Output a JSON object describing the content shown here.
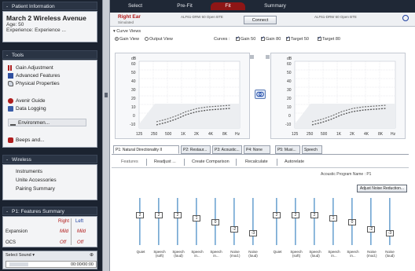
{
  "patient": {
    "header": "Patient Information",
    "name": "March 2 Wireless Avenue",
    "age": "Age: 50",
    "experience": "Experience: Experience ..."
  },
  "tools": {
    "header": "Tools",
    "items": [
      "Gain Adjustment",
      "Advanced Features",
      "Physical Properties",
      "Avenir Guide",
      "Data Logging",
      "Environmen...",
      "Beeps and..."
    ]
  },
  "wireless": {
    "header": "Wireless",
    "items": [
      "Instruments",
      "Unite Accessories",
      "Pairing Summary"
    ]
  },
  "features_summary": {
    "header": "P1: Features Summary",
    "col_right": "Right",
    "col_left": "Left",
    "row_label": "Expansion",
    "right_val": "Mild",
    "left_val": "Mild",
    "row2": "OCS",
    "row2_right": "Off",
    "row2_left": "Off"
  },
  "sound_select": {
    "label": "Select Sound",
    "time": "00:00/00:00"
  },
  "tabstrip": {
    "tabs": [
      "Select",
      "Pre-Fit",
      "Fit",
      "Summary"
    ],
    "active": "Fit"
  },
  "device": {
    "right_ear": "Right Ear",
    "right_ear_sub": "Simulated",
    "right_device": "ALF61-DRW 60 Open BTE",
    "connect_label": "Connect",
    "left_device": "ALF61-DRW 60 Open BTE"
  },
  "curve_view": {
    "label": "Curve Views",
    "gain_view": "Gain View",
    "output_view": "Output View",
    "curves_label": "Curves :",
    "checks": [
      "Gain 50",
      "Gain 80",
      "Target 50",
      "Target 80"
    ]
  },
  "chart": {
    "y_unit": "dB",
    "y_ticks": [
      "60",
      "50",
      "40",
      "30",
      "20",
      "10",
      "0",
      "-10"
    ],
    "x_ticks": [
      "125",
      "250",
      "500",
      "1K",
      "2K",
      "4K",
      "8K"
    ],
    "x_unit": "Hz"
  },
  "feature_tabs": [
    "P1: Natural Directionality II",
    "P2: Restaur...",
    "P3: Acoustic...",
    "P4: None",
    "P5: Musi...",
    "Speech"
  ],
  "sub_tabs": [
    "Features",
    "Readjust ...",
    "Create Comparison",
    "Recalculate",
    "Autorelate"
  ],
  "acoustic_info": "Acoustic Program Name : P1",
  "adjust_button": "Adjust Noise Reduction...",
  "sliders": {
    "right": [
      {
        "label": "Quiet",
        "value": "2"
      },
      {
        "label": "Speech (soft)",
        "value": "2"
      },
      {
        "label": "Speech (loud)",
        "value": "2"
      },
      {
        "label": "Speech in...",
        "value": "1"
      },
      {
        "label": "Speech in...",
        "value": "0"
      },
      {
        "label": "Noise (mod.)",
        "value": "-2"
      },
      {
        "label": "Noise (loud)",
        "value": "-3"
      }
    ],
    "left": [
      {
        "label": "Quiet",
        "value": "2"
      },
      {
        "label": "Speech (soft)",
        "value": "2"
      },
      {
        "label": "Speech (loud)",
        "value": "2"
      },
      {
        "label": "Speech in...",
        "value": "1"
      },
      {
        "label": "Speech in...",
        "value": "0"
      },
      {
        "label": "Noise (mod.)",
        "value": "-2"
      },
      {
        "label": "Noise (loud)",
        "value": "-3"
      }
    ]
  }
}
